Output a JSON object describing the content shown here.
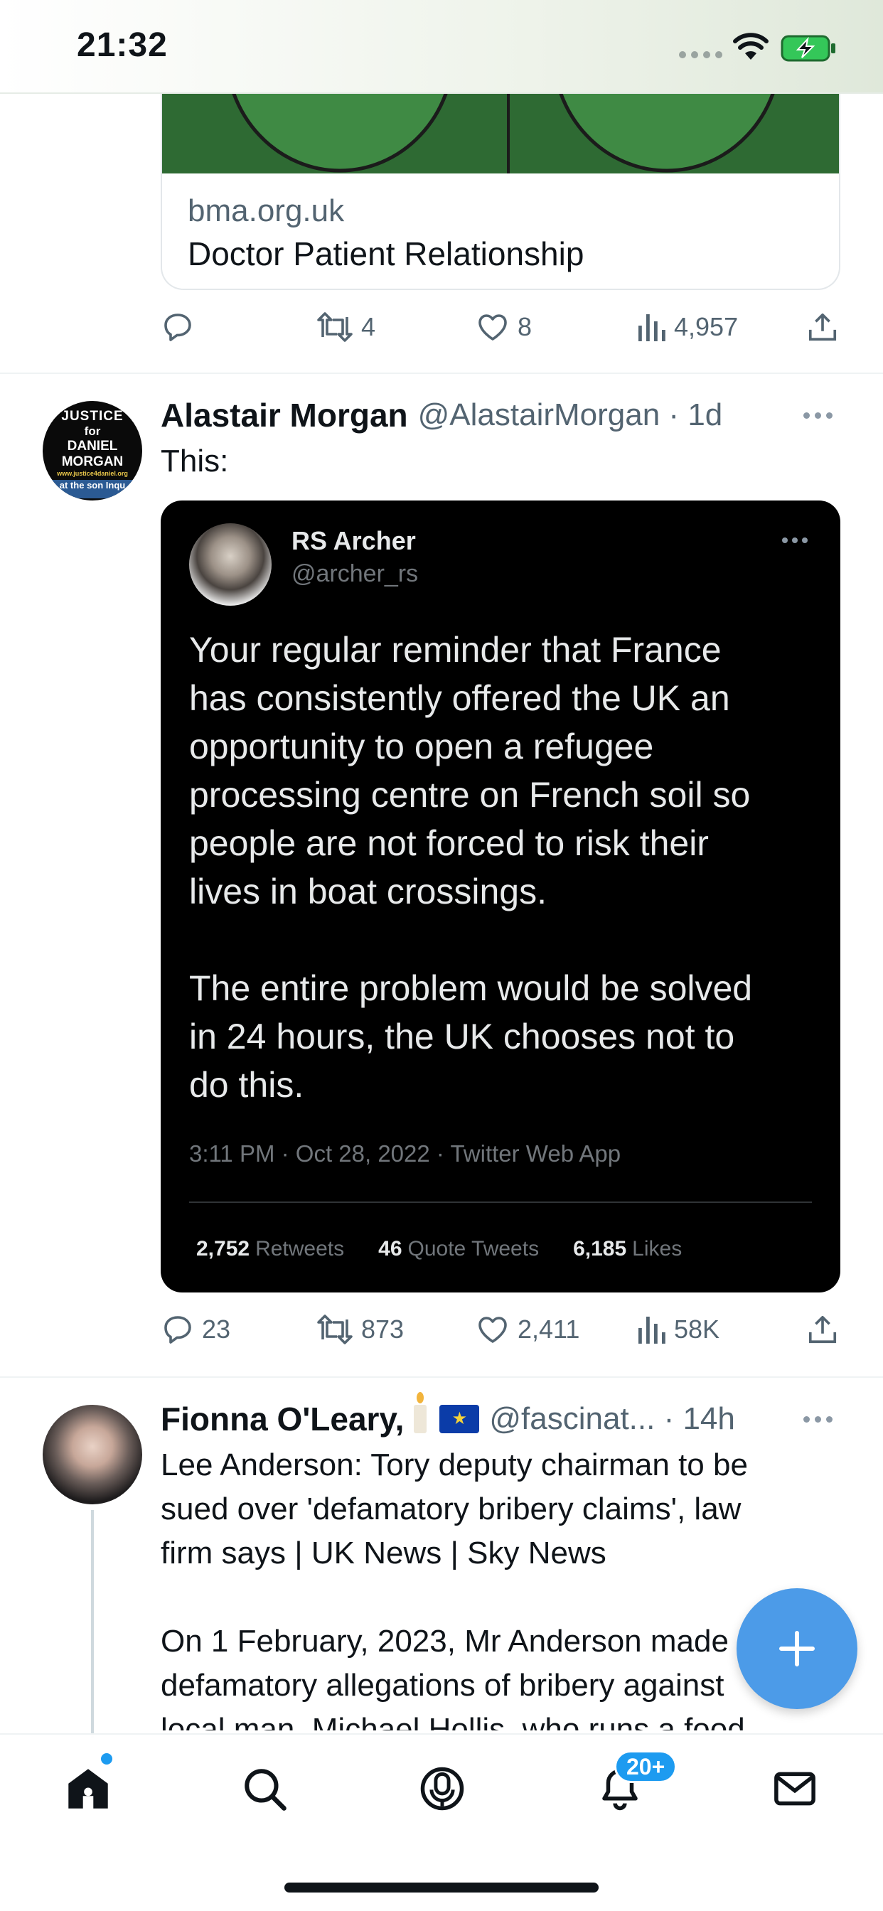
{
  "status_bar": {
    "time": "21:32",
    "icons": [
      "signal-dots-icon",
      "wifi-icon",
      "battery-charging-icon"
    ]
  },
  "link_card": {
    "domain": "bma.org.uk",
    "title": "Doctor Patient Relationship",
    "image_color": "#2e6a33"
  },
  "tweet0_actions": {
    "replies": "",
    "retweets": "4",
    "likes": "8",
    "views": "4,957"
  },
  "tweet1": {
    "author_name": "Alastair Morgan",
    "handle_time": "@AlastairMorgan · 1d",
    "text": "This:",
    "avatar_text": {
      "line1": "JUSTICE",
      "line2": "for",
      "line3": "DANIEL",
      "line4": "MORGAN",
      "line5": "www.justice4daniel.org",
      "line6": "at the",
      "line7": "son Inqu"
    },
    "embedded_tweet": {
      "author_name": "RS Archer",
      "handle": "@archer_rs",
      "body": "Your regular reminder that France\nhas consistently offered the UK an\nopportunity to open a refugee\nprocessing centre on French soil so\npeople are not forced to risk their\nlives in boat crossings.\n\nThe entire problem would be solved\nin 24 hours, the UK chooses not to\ndo this.",
      "meta": "3:11 PM · Oct 28, 2022 · Twitter Web App",
      "retweets_count": "2,752",
      "retweets_label": "Retweets",
      "quotes_count": "46",
      "quotes_label": "Quote Tweets",
      "likes_count": "6,185",
      "likes_label": "Likes"
    },
    "actions": {
      "replies": "23",
      "retweets": "873",
      "likes": "2,411",
      "views": "58K"
    }
  },
  "tweet2": {
    "author_name": "Fionna O'Leary,",
    "handle_time": "@fascinat... · 14h",
    "text": "Lee Anderson: Tory deputy chairman to be\nsued over 'defamatory bribery claims', law\nfirm says | UK News | Sky News\n\nOn 1 February, 2023, Mr Anderson made\ndefamatory allegations of bribery against\nlocal man, Michael Hollis, who runs a food"
  },
  "tab_bar": {
    "notifications_badge": "20+",
    "tabs": [
      "home",
      "search",
      "spaces",
      "notifications",
      "messages"
    ]
  },
  "colors": {
    "accent": "#1d9bf0",
    "fab": "#4c9be8",
    "secondary_text": "#536471"
  }
}
